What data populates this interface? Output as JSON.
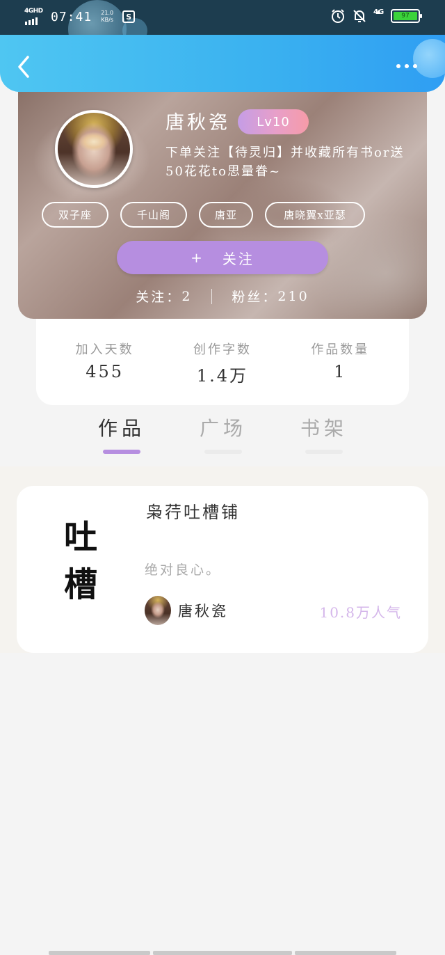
{
  "status_bar": {
    "network": "4GHD",
    "time": "07:41",
    "speed": "21.0",
    "speed_unit": "KB/s",
    "app_icon": "s-icon",
    "network_right": "4G",
    "battery_level": "97",
    "battery_color": "#3bd33b"
  },
  "header": {
    "back_icon": "chevron-left-icon",
    "more_icon": "more-horizontal-icon",
    "bar_color": "#3ab1f0"
  },
  "profile": {
    "name": "唐秋瓷",
    "level": "Lv10",
    "bio": "下单关注【待灵归】并收藏所有书or送50花花to思量眷~",
    "tags": [
      "双子座",
      "千山阁",
      "唐亚",
      "唐晓翼x亚瑟"
    ],
    "follow_button": "关注",
    "follow_button_icon": "+",
    "following_label": "关注：",
    "following_count": "2",
    "fans_label": "粉丝：",
    "fans_count": "210",
    "accent_color": "#b68ee0"
  },
  "stats": [
    {
      "label": "加入天数",
      "value": "455"
    },
    {
      "label": "创作字数",
      "value": "1.4万"
    },
    {
      "label": "作品数量",
      "value": "1"
    }
  ],
  "tabs": [
    {
      "label": "作品",
      "active": true
    },
    {
      "label": "广场",
      "active": false
    },
    {
      "label": "书架",
      "active": false
    }
  ],
  "works": [
    {
      "cover_text_line1": "吐",
      "cover_text_line2": "槽",
      "title": "枭荇吐槽铺",
      "description": "绝对良心。",
      "author": "唐秋瓷",
      "popularity": "10.8万人气"
    }
  ]
}
